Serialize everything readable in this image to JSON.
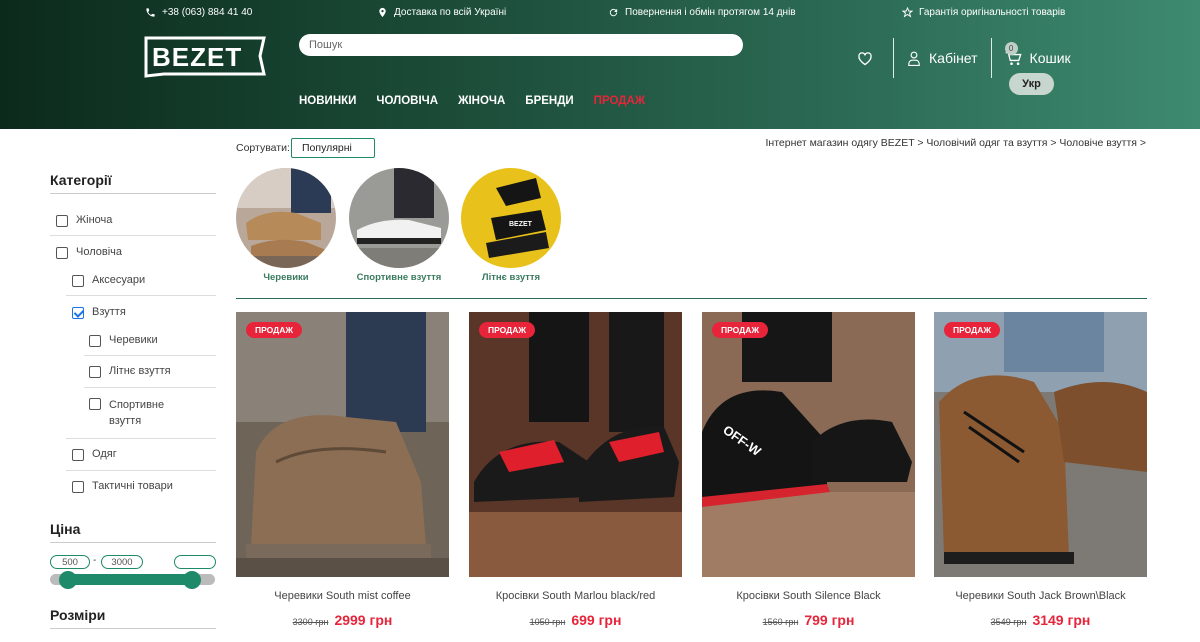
{
  "topbar": {
    "phone": "+38 (063) 884 41 40",
    "delivery": "Доставка по всій Україні",
    "returns": "Повернення і обмін протягом 14 днів",
    "guarantee": "Гарантія оригінальності товарів"
  },
  "brand": {
    "logo_text": "BEZET"
  },
  "search": {
    "placeholder": "Пошук"
  },
  "nav": {
    "new": "НОВИНКИ",
    "men": "ЧОЛОВІЧА",
    "women": "ЖІНОЧА",
    "brands": "БРЕНДИ",
    "sale": "ПРОДАЖ"
  },
  "account": {
    "label": "Кабінет"
  },
  "cart": {
    "label": "Кошик",
    "count": "0"
  },
  "lang": {
    "label": "Укр"
  },
  "sort": {
    "label": "Сортувати:",
    "value": "Популярні"
  },
  "breadcrumb": "Інтернет магазин одягу BEZET > Чоловічий одяг та взуття > Чоловіче взуття >",
  "sidebar": {
    "categories_title": "Категорії",
    "items": {
      "women": "Жіноча",
      "men": "Чоловіча",
      "accessories": "Аксесуари",
      "shoes": "Взуття",
      "boots": "Черевики",
      "summer": "Літнє взуття",
      "sport": "Спортивне взуття",
      "clothes": "Одяг",
      "tactical": "Тактичні товари"
    },
    "price_title": "Ціна",
    "price_min": "500",
    "price_sep": "-",
    "price_max": "3000",
    "sizes_title": "Розміри"
  },
  "subcategories": [
    "Черевики",
    "Спортивне взуття",
    "Літнє взуття"
  ],
  "products": [
    {
      "tag": "ПРОДАЖ",
      "name": "Черевики South mist coffee",
      "old_price": "3300 грн",
      "price": "2999 грн"
    },
    {
      "tag": "ПРОДАЖ",
      "name": "Кросівки South Marlou black/red",
      "old_price": "1050 грн",
      "price": "699 грн"
    },
    {
      "tag": "ПРОДАЖ",
      "name": "Кросівки South Silence Black",
      "old_price": "1560 грн",
      "price": "799 грн"
    },
    {
      "tag": "ПРОДАЖ",
      "name": "Черевики South Jack Brown\\Black",
      "old_price": "3549 грн",
      "price": "3149 грн"
    }
  ],
  "colors": {
    "accent": "#1f8a6a",
    "sale": "#e8243a",
    "header_dark": "#0c2a1c"
  }
}
